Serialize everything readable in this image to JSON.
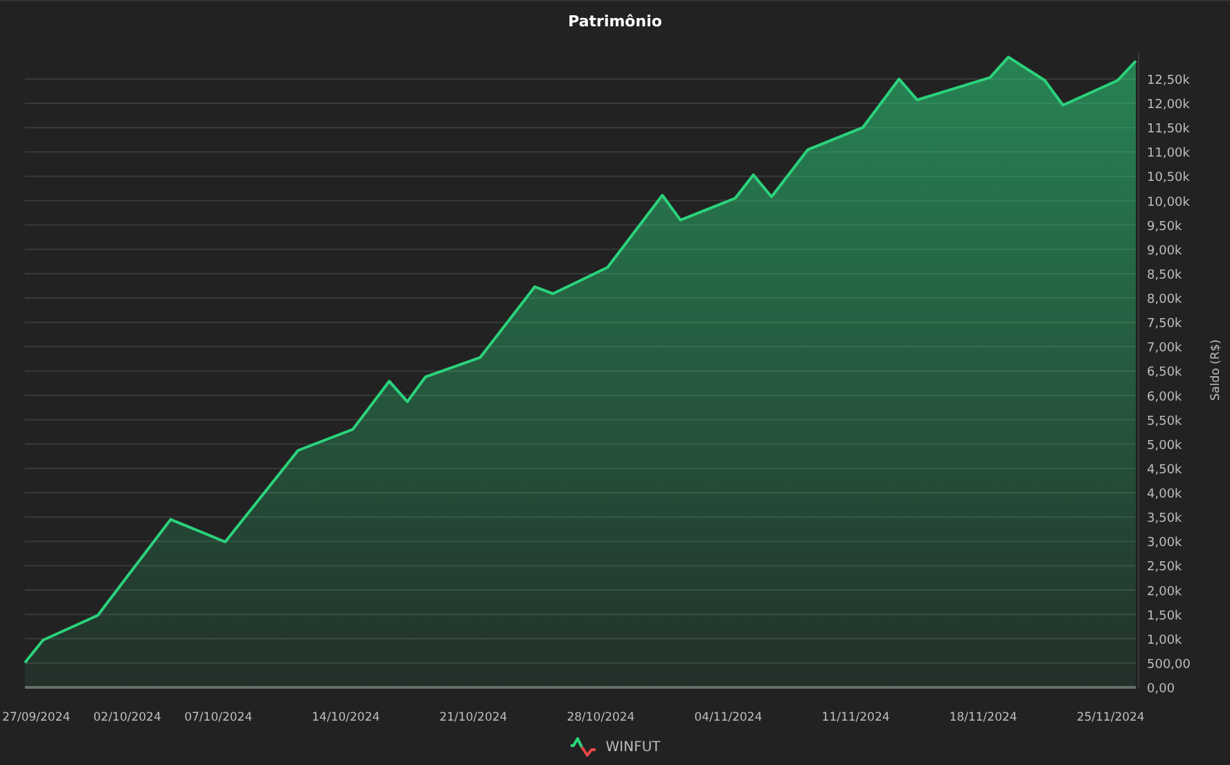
{
  "title": "Patrimônio",
  "chart_data": {
    "type": "area",
    "ylabel": "Saldo (R$)",
    "categories": [
      null,
      "27/09/2024",
      null,
      null,
      null,
      null,
      "02/10/2024",
      null,
      null,
      null,
      null,
      "07/10/2024",
      null,
      null,
      null,
      null,
      null,
      null,
      "14/10/2024",
      null,
      null,
      null,
      null,
      null,
      null,
      "21/10/2024",
      null,
      null,
      null,
      null,
      null,
      null,
      "28/10/2024",
      null,
      null,
      null,
      null,
      null,
      null,
      "04/11/2024",
      null,
      null,
      null,
      null,
      null,
      null,
      "11/11/2024",
      null,
      null,
      null,
      null,
      null,
      null,
      "18/11/2024",
      null,
      null,
      null,
      null,
      null,
      null,
      "25/11/2024",
      null
    ],
    "series": [
      {
        "name": "WINFUT",
        "color": "#2bd37c",
        "values": [
          510,
          970,
          null,
          null,
          1480,
          null,
          null,
          null,
          3450,
          null,
          null,
          2990,
          null,
          null,
          null,
          4870,
          null,
          null,
          5300,
          null,
          6290,
          5870,
          6380,
          null,
          null,
          6780,
          null,
          null,
          8230,
          8090,
          null,
          null,
          8630,
          null,
          null,
          10110,
          9600,
          null,
          null,
          10050,
          10530,
          10080,
          null,
          11050,
          null,
          null,
          11500,
          null,
          12500,
          12070,
          null,
          null,
          null,
          12530,
          12950,
          null,
          12470,
          11960,
          null,
          null,
          12470,
          12870
        ]
      }
    ],
    "grid": true,
    "ylim": [
      0,
      13040
    ],
    "yticks": [
      {
        "value": 0,
        "label": "0,00"
      },
      {
        "value": 500,
        "label": "500,00"
      },
      {
        "value": 1000,
        "label": "1,00k"
      },
      {
        "value": 1500,
        "label": "1,50k"
      },
      {
        "value": 2000,
        "label": "2,00k"
      },
      {
        "value": 2500,
        "label": "2,50k"
      },
      {
        "value": 3000,
        "label": "3,00k"
      },
      {
        "value": 3500,
        "label": "3,50k"
      },
      {
        "value": 4000,
        "label": "4,00k"
      },
      {
        "value": 4500,
        "label": "4,50k"
      },
      {
        "value": 5000,
        "label": "5,00k"
      },
      {
        "value": 5500,
        "label": "5,50k"
      },
      {
        "value": 6000,
        "label": "6,00k"
      },
      {
        "value": 6500,
        "label": "6,50k"
      },
      {
        "value": 7000,
        "label": "7,00k"
      },
      {
        "value": 7500,
        "label": "7,50k"
      },
      {
        "value": 8000,
        "label": "8,00k"
      },
      {
        "value": 8500,
        "label": "8,50k"
      },
      {
        "value": 9000,
        "label": "9,00k"
      },
      {
        "value": 9500,
        "label": "9,50k"
      },
      {
        "value": 10000,
        "label": "10,00k"
      },
      {
        "value": 10500,
        "label": "10,50k"
      },
      {
        "value": 11000,
        "label": "11,00k"
      },
      {
        "value": 11500,
        "label": "11,50k"
      },
      {
        "value": 12000,
        "label": "12,00k"
      },
      {
        "value": 12500,
        "label": "12,50k"
      }
    ]
  }
}
